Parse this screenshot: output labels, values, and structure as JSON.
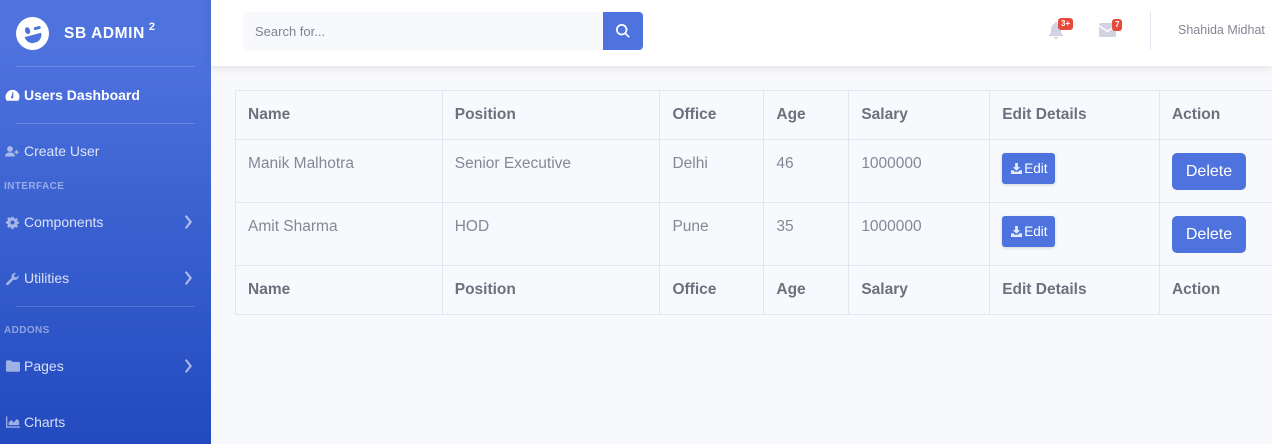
{
  "brand": {
    "name": "SB ADMIN",
    "sup": "2"
  },
  "sidebar": {
    "dashboard": "Users Dashboard",
    "create_user": "Create User",
    "interface_heading": "INTERFACE",
    "components": "Components",
    "utilities": "Utilities",
    "addons_heading": "ADDONS",
    "pages": "Pages",
    "charts": "Charts"
  },
  "topbar": {
    "search_placeholder": "Search for...",
    "alerts_badge": "3+",
    "messages_badge": "7",
    "user_name": "Shahida Midhat"
  },
  "table": {
    "headers": [
      "Name",
      "Position",
      "Office",
      "Age",
      "Salary",
      "Edit Details",
      "Action"
    ],
    "rows": [
      {
        "name": "Manik Malhotra",
        "position": "Senior Executive",
        "office": "Delhi",
        "age": "46",
        "salary": "1000000",
        "edit": "Edit",
        "action": "Delete"
      },
      {
        "name": "Amit Sharma",
        "position": "HOD",
        "office": "Pune",
        "age": "35",
        "salary": "1000000",
        "edit": "Edit",
        "action": "Delete"
      }
    ],
    "footers": [
      "Name",
      "Position",
      "Office",
      "Age",
      "Salary",
      "Edit Details",
      "Action"
    ]
  },
  "colors": {
    "primary": "#4e73df",
    "sidebar_dark": "#224abe",
    "danger": "#e74a3b",
    "background": "#f8f9fc"
  }
}
